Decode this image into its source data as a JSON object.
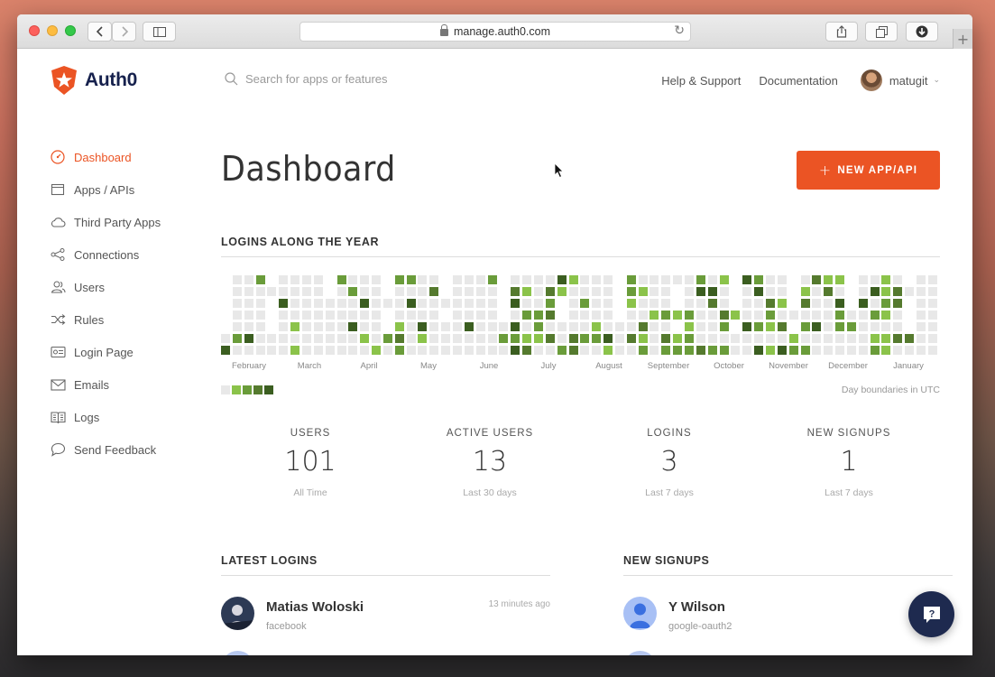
{
  "browser": {
    "url": "manage.auth0.com"
  },
  "header": {
    "logo_text": "Auth0",
    "search_placeholder": "Search for apps or features",
    "help_label": "Help & Support",
    "docs_label": "Documentation",
    "username": "matugit"
  },
  "sidebar": {
    "items": [
      {
        "label": "Dashboard",
        "icon": "dashboard-gauge-icon",
        "active": true
      },
      {
        "label": "Apps / APIs",
        "icon": "apps-window-icon"
      },
      {
        "label": "Third Party Apps",
        "icon": "cloud-icon"
      },
      {
        "label": "Connections",
        "icon": "connections-share-icon"
      },
      {
        "label": "Users",
        "icon": "users-icon"
      },
      {
        "label": "Rules",
        "icon": "rules-shuffle-icon"
      },
      {
        "label": "Login Page",
        "icon": "login-card-icon"
      },
      {
        "label": "Emails",
        "icon": "envelope-icon"
      },
      {
        "label": "Logs",
        "icon": "logs-book-icon"
      },
      {
        "label": "Send Feedback",
        "icon": "speech-bubble-icon"
      }
    ]
  },
  "main": {
    "title": "Dashboard",
    "new_button_label": "NEW APP/API",
    "logins_section_title": "LOGINS ALONG THE YEAR",
    "months": [
      "February",
      "March",
      "April",
      "May",
      "June",
      "July",
      "August",
      "September",
      "October",
      "November",
      "December",
      "January"
    ],
    "timezone_note": "Day boundaries in UTC",
    "heatmap_colors": [
      "#e8e8e8",
      "#8bc34a",
      "#6a9c3a",
      "#557a2e",
      "#3b5e20"
    ],
    "stats": [
      {
        "label": "USERS",
        "value": "101",
        "sub": "All Time"
      },
      {
        "label": "ACTIVE USERS",
        "value": "13",
        "sub": "Last 30 days"
      },
      {
        "label": "LOGINS",
        "value": "3",
        "sub": "Last 7 days"
      },
      {
        "label": "NEW SIGNUPS",
        "value": "1",
        "sub": "Last 7 days"
      }
    ],
    "latest_logins_title": "LATEST LOGINS",
    "new_signups_title": "NEW SIGNUPS",
    "latest_logins": [
      {
        "name": "Matias Woloski",
        "connection": "facebook",
        "time": "13 minutes ago"
      }
    ],
    "new_signups": [
      {
        "name": "Y Wilson",
        "connection": "google-oauth2"
      }
    ]
  }
}
